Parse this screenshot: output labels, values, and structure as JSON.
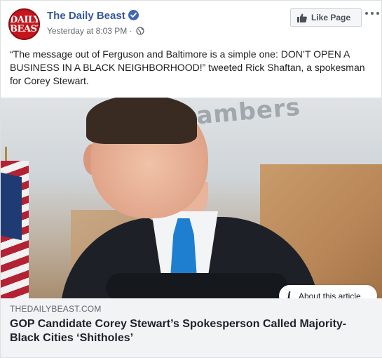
{
  "post": {
    "page_name": "The Daily Beast",
    "timestamp": "Yesterday at 8:03 PM",
    "timestamp_separator": "·",
    "avatar_logo": {
      "line1": "DAILY",
      "line2": "BEAST"
    },
    "like_button_label": "Like Page",
    "message": "“The message out of Ferguson and Baltimore is a simple one: DON’T OPEN A BUSINESS IN A BLACK NEIGHBORHOOD!” tweeted Rick Shaftan, a spokesman for Corey Stewart.",
    "photo_sign_text": "d Chambers",
    "about_article_label": "About this article",
    "link": {
      "domain": "THEDAILYBEAST.COM",
      "headline": "GOP Candidate Corey Stewart’s Spokesperson Called Majority-Black Cities ‘Shitholes’"
    }
  },
  "icons": {
    "verified": "verified-badge-icon",
    "privacy": "globe-icon",
    "like": "thumbs-up-icon",
    "more": "more-options-icon",
    "info": "info-icon"
  },
  "colors": {
    "brand_link": "#385898",
    "verified_blue": "#4267b2",
    "logo_red": "#c4161c",
    "link_preview_bg": "#f2f3f5"
  }
}
